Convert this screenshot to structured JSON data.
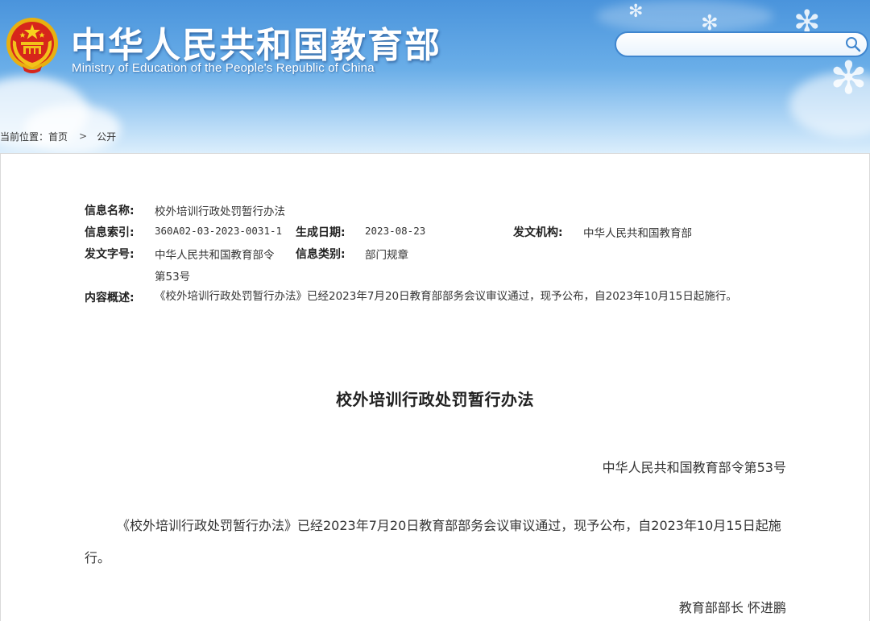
{
  "header": {
    "title": "中华人民共和国教育部",
    "subtitle": "Ministry of Education of the People's Republic of China",
    "search": {
      "value": "",
      "placeholder": "",
      "icon": "search-icon"
    },
    "brand_color": "#4a94dc"
  },
  "breadcrumb": {
    "prefix": "当前位置：",
    "home": "首页",
    "separator": ">",
    "current": "公开"
  },
  "meta": {
    "info_name": {
      "label": "信息名称:",
      "value": "校外培训行政处罚暂行办法"
    },
    "info_index": {
      "label": "信息索引:",
      "value": "360A02-03-2023-0031-1"
    },
    "date_generated": {
      "label": "生成日期:",
      "value": "2023-08-23"
    },
    "issuing_agency": {
      "label": "发文机构:",
      "value": "中华人民共和国教育部"
    },
    "doc_number": {
      "label": "发文字号:",
      "value_line1": "中华人民共和国教育部令",
      "value_line2": "第53号"
    },
    "info_category": {
      "label": "信息类别:",
      "value": "部门规章"
    },
    "summary": {
      "label": "内容概述:",
      "value": "《校外培训行政处罚暂行办法》已经2023年7月20日教育部部务会议审议通过，现予公布，自2023年10月15日起施行。"
    }
  },
  "document": {
    "title": "校外培训行政处罚暂行办法",
    "order_number": "中华人民共和国教育部令第53号",
    "body": "《校外培训行政处罚暂行办法》已经2023年7月20日教育部部务会议审议通过，现予公布，自2023年10月15日起施行。",
    "signature": "教育部部长 怀进鹏"
  }
}
